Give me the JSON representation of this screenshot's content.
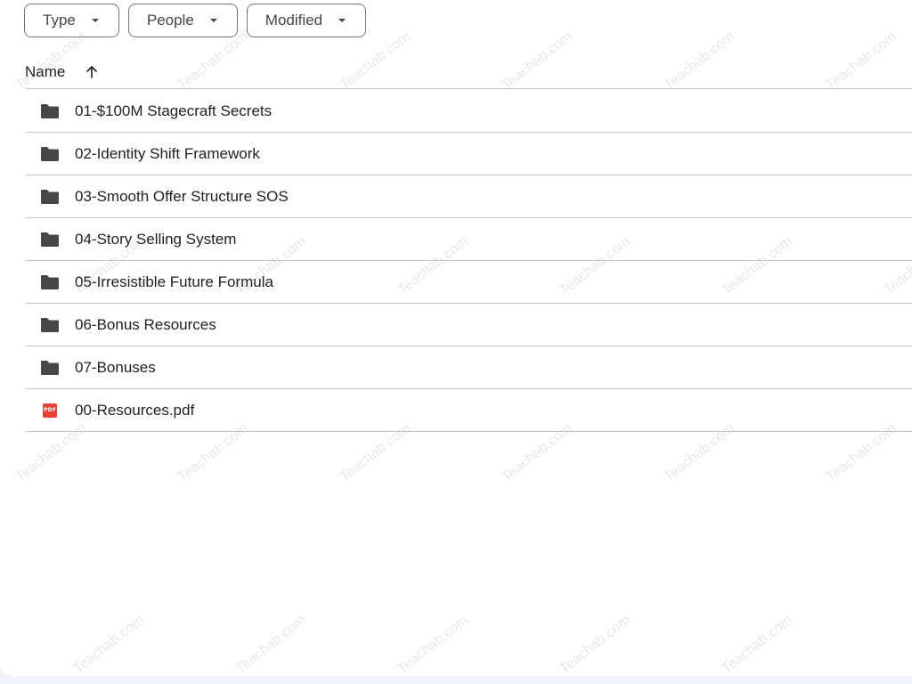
{
  "filters": [
    {
      "label": "Type"
    },
    {
      "label": "People"
    },
    {
      "label": "Modified"
    }
  ],
  "header": {
    "name_label": "Name",
    "sort_direction": "ascending"
  },
  "items": [
    {
      "name": "01-$100M Stagecraft Secrets",
      "type": "folder"
    },
    {
      "name": "02-Identity Shift Framework",
      "type": "folder"
    },
    {
      "name": "03-Smooth Offer Structure SOS",
      "type": "folder"
    },
    {
      "name": "04-Story Selling System",
      "type": "folder"
    },
    {
      "name": "05-Irresistible Future Formula",
      "type": "folder"
    },
    {
      "name": "06-Bonus Resources",
      "type": "folder"
    },
    {
      "name": "07-Bonuses",
      "type": "folder"
    },
    {
      "name": "00-Resources.pdf",
      "type": "pdf",
      "badge": "PDF"
    }
  ],
  "watermark": "Teachab.com",
  "colors": {
    "folder_icon": "#444746",
    "pdf_icon": "#ea4335",
    "divider": "#c7c7c7",
    "chip_border": "#747775"
  }
}
